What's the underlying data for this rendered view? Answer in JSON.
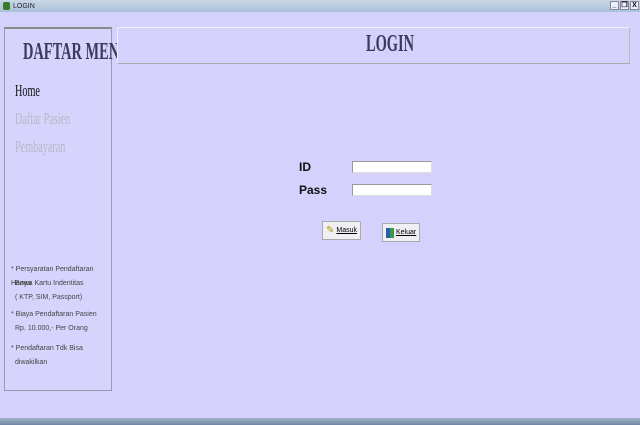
{
  "window": {
    "title": "LOGIN",
    "controls": [
      "_",
      "❐",
      "X"
    ]
  },
  "sidebar": {
    "title": "DAFTAR MENU",
    "items": [
      {
        "label": "Home",
        "color": "#111111"
      },
      {
        "label": "Daftar Pasien",
        "color": "#b8b8c8"
      },
      {
        "label": "Pembayaran",
        "color": "#b8b8c8"
      }
    ],
    "notes": [
      "* Persyaratan Pendaftaran Hanya",
      "Bawa Kartu Indentitas",
      "( KTP, SIM, Passport)",
      "* Biaya Pendaftaran Pasien",
      "Rp. 10.000,- Per Orang",
      "* Pendaftaran Tdk Bisa",
      "diwakilkan"
    ]
  },
  "header": {
    "title": "LOGIN"
  },
  "form": {
    "id_label": "ID",
    "id_value": "",
    "pass_label": "Pass",
    "pass_value": "",
    "login_button": "Masuk",
    "exit_button": "Keluar"
  }
}
